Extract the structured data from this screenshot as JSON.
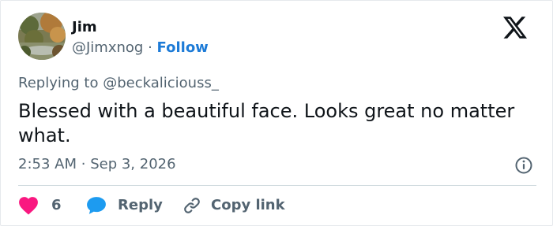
{
  "author": {
    "name": "Jim",
    "handle": "@Jimxnog",
    "separator": "·",
    "follow_label": "Follow"
  },
  "reply_context": {
    "prefix": "Replying to",
    "mention": "@beckaliciouss_"
  },
  "tweet": {
    "text": "Blessed with a beautiful face. Looks great no matter what.",
    "time": "2:53 AM",
    "separator": "·",
    "date": "Sep 3, 2026"
  },
  "actions": {
    "like_count": "6",
    "reply_label": "Reply",
    "copy_link_label": "Copy link"
  },
  "icons": {
    "logo": "x-logo-icon",
    "info": "info-icon",
    "like": "heart-icon",
    "reply": "speech-bubble-icon",
    "copy": "link-icon"
  },
  "colors": {
    "like": "#f91880",
    "reply": "#1d9bf0",
    "follow": "#1d7bd7",
    "muted": "#536471",
    "text": "#0f1419"
  }
}
